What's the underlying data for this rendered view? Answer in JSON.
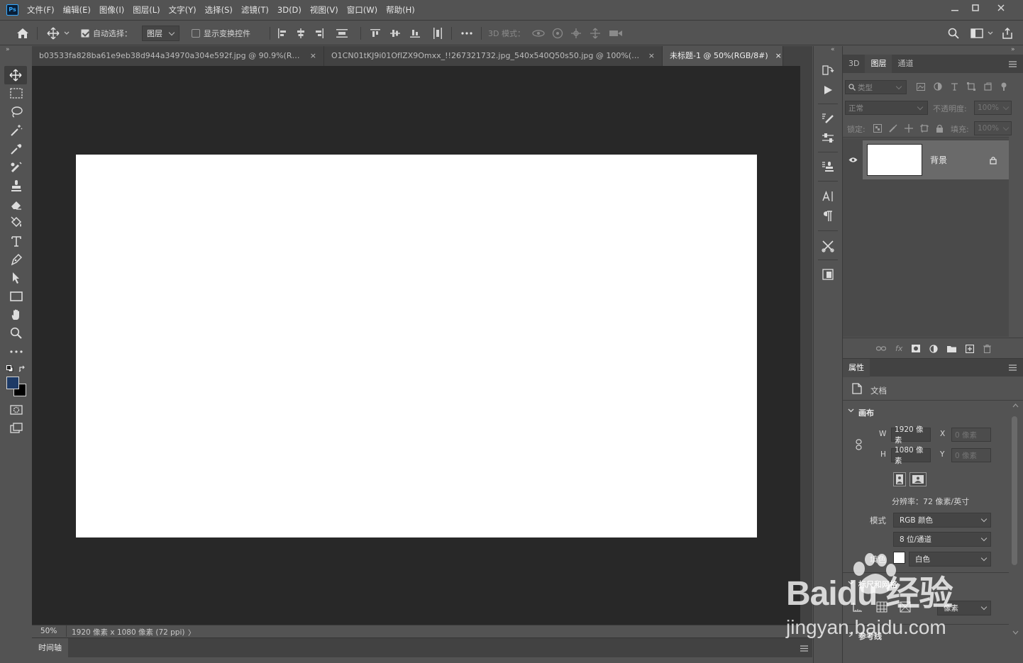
{
  "app": {
    "logo": "Ps"
  },
  "menu": [
    "文件(F)",
    "编辑(E)",
    "图像(I)",
    "图层(L)",
    "文字(Y)",
    "选择(S)",
    "滤镜(T)",
    "3D(D)",
    "视图(V)",
    "窗口(W)",
    "帮助(H)"
  ],
  "options": {
    "auto_select_label": "自动选择：",
    "auto_select_target": "图层",
    "show_transform_label": "显示变换控件",
    "mode_3d_label": "3D 模式："
  },
  "tabs": [
    {
      "title": "b03533fa828ba61e9eb38d944a34970a304e592f.jpg @ 90.9%(RGB/8#...",
      "close": "×"
    },
    {
      "title": "O1CN01tKJ9i01OfIZX9Omxx_!!267321732.jpg_540x540Q50s50.jpg @ 100%(RGB/...",
      "close": "×"
    },
    {
      "title": "未标题-1 @ 50%(RGB/8#)",
      "close": "×",
      "active": true
    }
  ],
  "status": {
    "zoom": "50%",
    "doc_info": "1920 像素 x 1080 像素 (72 ppi)",
    "arrow": "〉"
  },
  "timeline": {
    "label": "时间轴"
  },
  "layers_panel": {
    "tabs": [
      "3D",
      "图层",
      "通道"
    ],
    "filter_placeholder": "类型",
    "blend_mode": "正常",
    "opacity_label": "不透明度:",
    "opacity_value": "100%",
    "lock_label": "锁定:",
    "fill_label": "填充:",
    "fill_value": "100%",
    "layers": [
      {
        "name": "背景"
      }
    ]
  },
  "properties_panel": {
    "tab": "属性",
    "doc_label": "文档",
    "canvas_section": "画布",
    "w_label": "W",
    "w_value": "1920 像素",
    "h_label": "H",
    "h_value": "1080 像素",
    "x_label": "X",
    "x_value": "0 像素",
    "y_label": "Y",
    "y_value": "0 像素",
    "resolution": "分辨率：72 像素/英寸",
    "mode_label": "模式",
    "mode_value": "RGB 颜色",
    "depth_value": "8 位/通道",
    "fill_label": "填色",
    "fill_value": "白色",
    "rulers_section": "标尺和网格",
    "unit_value": "像素",
    "guides_section": "参考线"
  },
  "watermark": {
    "line1": "Baidu 经验",
    "line2": "jingyan.baidu.com"
  },
  "colors": {
    "foreground": "#1d3a66",
    "background": "#000000",
    "accent": "#31a8ff"
  }
}
